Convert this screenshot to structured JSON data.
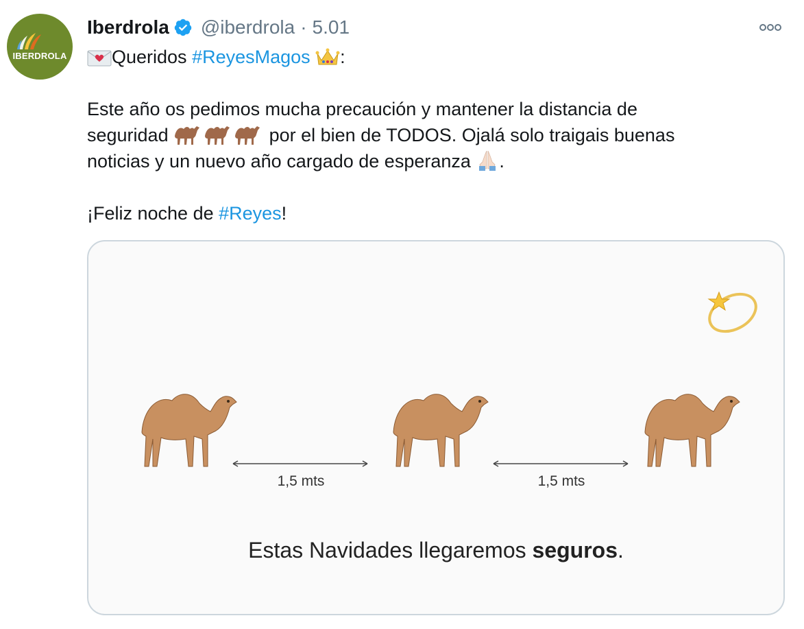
{
  "tweet": {
    "avatar_text": "IBERDROLA",
    "name": "Iberdrola",
    "handle": "@iberdrola",
    "separator": "·",
    "date": "5.01",
    "line1_text": "Queridos ",
    "line1_hashtag": "#ReyesMagos",
    "line1_end": ":",
    "line2": "Este año os pedimos mucha precaución y mantener la distancia de",
    "line3_start": "seguridad ",
    "line3_end": " por el bien de TODOS. Ojalá solo traigais buenas",
    "line4_start": "noticias y un nuevo año cargado de esperanza ",
    "line4_end": ".",
    "line5_start": "¡Feliz noche de ",
    "line5_hashtag": "#Reyes",
    "line5_end": "!"
  },
  "media": {
    "distance_label_1": "1,5 mts",
    "distance_label_2": "1,5 mts",
    "caption_start": "Estas Navidades llegaremos ",
    "caption_bold": "seguros",
    "caption_end": "."
  },
  "icons": {
    "verified": "verified-badge-icon",
    "more": "more-options-icon",
    "love_letter": "love-letter-icon",
    "crown": "crown-icon",
    "camel": "camel-icon",
    "praying_hands": "praying-hands-icon",
    "comet": "comet-icon"
  },
  "colors": {
    "hashtag": "#1b95e0",
    "verified": "#1da1f2",
    "avatar_bg": "#6e8a2c",
    "muted": "#657786",
    "media_border": "#ccd6dd"
  }
}
